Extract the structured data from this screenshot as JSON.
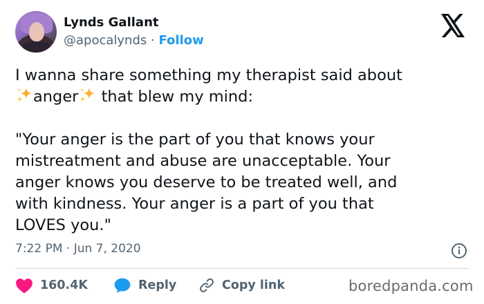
{
  "user": {
    "name": "Lynds Gallant",
    "handle": "@apocalynds",
    "separator": "·",
    "follow_label": "Follow"
  },
  "tweet": {
    "line1": "I wanna share something my therapist said about",
    "anger_word": "anger",
    "line2_rest": " that blew my mind:",
    "quote": "\"Your anger is the part of you that knows your\nmistreatment and abuse are unacceptable. Your\nanger knows you deserve to be treated well, and\nwith kindness. Your anger is a part of you that\nLOVES you.\"",
    "timestamp": "7:22 PM · Jun 7, 2020"
  },
  "actions": {
    "likes_count": "160.4K",
    "reply_label": "Reply",
    "copy_link_label": "Copy link"
  },
  "watermark": "boredpanda.com",
  "icons": {
    "logo": "x-logo-icon",
    "sparkle": "sparkles-icon",
    "info": "info-icon",
    "heart": "heart-icon",
    "reply": "reply-bubble-icon",
    "link": "link-icon"
  },
  "colors": {
    "text": "#0f1419",
    "secondary": "#536471",
    "accent": "#1d9bf0",
    "heart": "#f91880",
    "sparkle": "#ffac33",
    "divider": "#cfd9de"
  }
}
